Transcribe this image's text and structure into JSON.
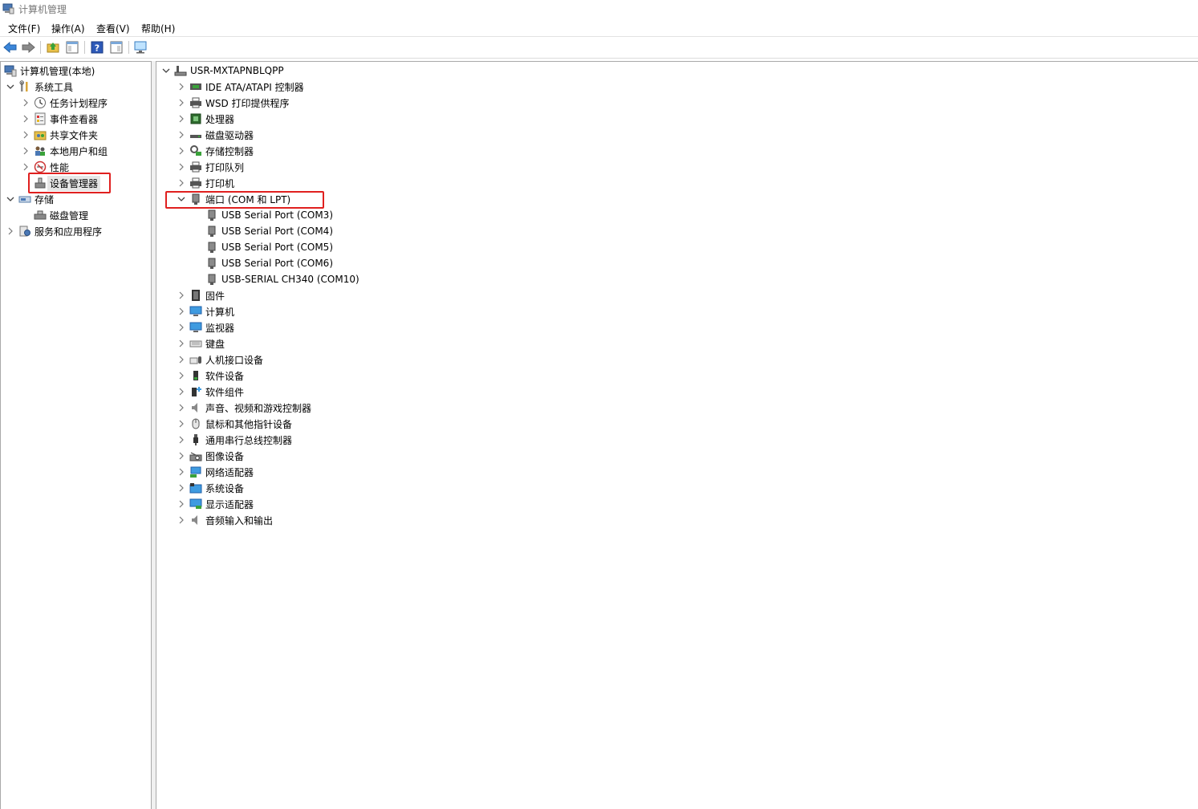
{
  "window": {
    "title": "计算机管理"
  },
  "menu": [
    "文件(F)",
    "操作(A)",
    "查看(V)",
    "帮助(H)"
  ],
  "toolbar": {
    "buttons": [
      "back-icon",
      "forward-icon",
      "up-folder-icon",
      "show-hide-tree-icon",
      "help-icon",
      "properties-pane-icon",
      "monitor-icon"
    ]
  },
  "left_tree": {
    "root": "计算机管理(本地)",
    "system_tools": "系统工具",
    "task_scheduler": "任务计划程序",
    "event_viewer": "事件查看器",
    "shared_folders": "共享文件夹",
    "local_users": "本地用户和组",
    "performance": "性能",
    "device_manager": "设备管理器",
    "storage": "存储",
    "disk_management": "磁盘管理",
    "services_apps": "服务和应用程序"
  },
  "device_tree": {
    "computer_name": "USR-MXTAPNBLQPP",
    "categories": [
      "IDE ATA/ATAPI 控制器",
      "WSD 打印提供程序",
      "处理器",
      "磁盘驱动器",
      "存储控制器",
      "打印队列",
      "打印机",
      "端口 (COM 和 LPT)",
      "固件",
      "计算机",
      "监视器",
      "键盘",
      "人机接口设备",
      "软件设备",
      "软件组件",
      "声音、视频和游戏控制器",
      "鼠标和其他指针设备",
      "通用串行总线控制器",
      "图像设备",
      "网络适配器",
      "系统设备",
      "显示适配器",
      "音频输入和输出"
    ],
    "ports": [
      "USB Serial Port (COM3)",
      "USB Serial Port (COM4)",
      "USB Serial Port (COM5)",
      "USB Serial Port (COM6)",
      "USB-SERIAL CH340 (COM10)"
    ]
  },
  "colors": {
    "highlight": "#e0201f",
    "selection": "#e6e6e6"
  }
}
